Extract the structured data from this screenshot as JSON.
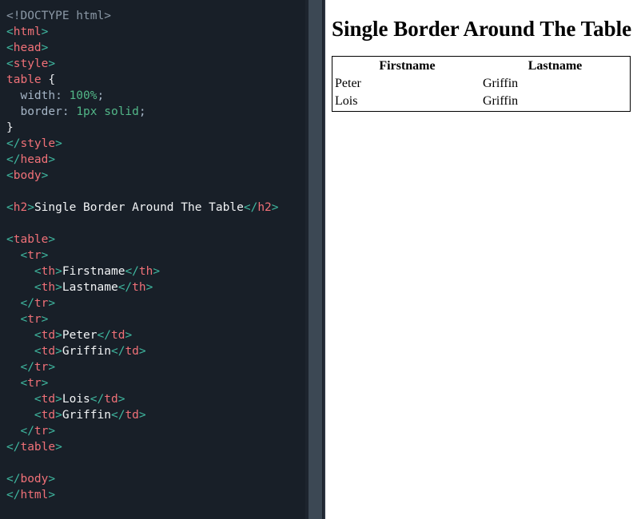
{
  "editor": {
    "language": "html",
    "background_color": "#181f28",
    "code_lines": [
      [
        {
          "t": "doctype",
          "s": "<!DOCTYPE html>"
        }
      ],
      [
        {
          "t": "punct",
          "s": "<"
        },
        {
          "t": "tag",
          "s": "html"
        },
        {
          "t": "punct",
          "s": ">"
        }
      ],
      [
        {
          "t": "punct",
          "s": "<"
        },
        {
          "t": "tag",
          "s": "head"
        },
        {
          "t": "punct",
          "s": ">"
        }
      ],
      [
        {
          "t": "punct",
          "s": "<"
        },
        {
          "t": "tag",
          "s": "style"
        },
        {
          "t": "punct",
          "s": ">"
        }
      ],
      [
        {
          "t": "sel",
          "s": "table"
        },
        {
          "t": "text",
          "s": " "
        },
        {
          "t": "brace",
          "s": "{"
        }
      ],
      [
        {
          "t": "prop",
          "s": "  width"
        },
        {
          "t": "semi",
          "s": ": "
        },
        {
          "t": "val",
          "s": "100%"
        },
        {
          "t": "semi",
          "s": ";"
        }
      ],
      [
        {
          "t": "prop",
          "s": "  border"
        },
        {
          "t": "semi",
          "s": ": "
        },
        {
          "t": "val",
          "s": "1px solid"
        },
        {
          "t": "semi",
          "s": ";"
        }
      ],
      [
        {
          "t": "brace",
          "s": "}"
        }
      ],
      [
        {
          "t": "punct",
          "s": "</"
        },
        {
          "t": "tag",
          "s": "style"
        },
        {
          "t": "punct",
          "s": ">"
        }
      ],
      [
        {
          "t": "punct",
          "s": "</"
        },
        {
          "t": "tag",
          "s": "head"
        },
        {
          "t": "punct",
          "s": ">"
        }
      ],
      [
        {
          "t": "punct",
          "s": "<"
        },
        {
          "t": "tag",
          "s": "body"
        },
        {
          "t": "punct",
          "s": ">"
        }
      ],
      [],
      [
        {
          "t": "punct",
          "s": "<"
        },
        {
          "t": "tag",
          "s": "h2"
        },
        {
          "t": "punct",
          "s": ">"
        },
        {
          "t": "text",
          "s": "Single Border Around The Table"
        },
        {
          "t": "punct",
          "s": "</"
        },
        {
          "t": "tag",
          "s": "h2"
        },
        {
          "t": "punct",
          "s": ">"
        }
      ],
      [],
      [
        {
          "t": "punct",
          "s": "<"
        },
        {
          "t": "tag",
          "s": "table"
        },
        {
          "t": "punct",
          "s": ">"
        }
      ],
      [
        {
          "t": "punct",
          "s": "  <"
        },
        {
          "t": "tag",
          "s": "tr"
        },
        {
          "t": "punct",
          "s": ">"
        }
      ],
      [
        {
          "t": "punct",
          "s": "    <"
        },
        {
          "t": "tag",
          "s": "th"
        },
        {
          "t": "punct",
          "s": ">"
        },
        {
          "t": "text",
          "s": "Firstname"
        },
        {
          "t": "punct",
          "s": "</"
        },
        {
          "t": "tag",
          "s": "th"
        },
        {
          "t": "punct",
          "s": ">"
        }
      ],
      [
        {
          "t": "punct",
          "s": "    <"
        },
        {
          "t": "tag",
          "s": "th"
        },
        {
          "t": "punct",
          "s": ">"
        },
        {
          "t": "text",
          "s": "Lastname"
        },
        {
          "t": "punct",
          "s": "</"
        },
        {
          "t": "tag",
          "s": "th"
        },
        {
          "t": "punct",
          "s": ">"
        }
      ],
      [
        {
          "t": "punct",
          "s": "  </"
        },
        {
          "t": "tag",
          "s": "tr"
        },
        {
          "t": "punct",
          "s": ">"
        }
      ],
      [
        {
          "t": "punct",
          "s": "  <"
        },
        {
          "t": "tag",
          "s": "tr"
        },
        {
          "t": "punct",
          "s": ">"
        }
      ],
      [
        {
          "t": "punct",
          "s": "    <"
        },
        {
          "t": "tag",
          "s": "td"
        },
        {
          "t": "punct",
          "s": ">"
        },
        {
          "t": "text",
          "s": "Peter"
        },
        {
          "t": "punct",
          "s": "</"
        },
        {
          "t": "tag",
          "s": "td"
        },
        {
          "t": "punct",
          "s": ">"
        }
      ],
      [
        {
          "t": "punct",
          "s": "    <"
        },
        {
          "t": "tag",
          "s": "td"
        },
        {
          "t": "punct",
          "s": ">"
        },
        {
          "t": "text",
          "s": "Griffin"
        },
        {
          "t": "punct",
          "s": "</"
        },
        {
          "t": "tag",
          "s": "td"
        },
        {
          "t": "punct",
          "s": ">"
        }
      ],
      [
        {
          "t": "punct",
          "s": "  </"
        },
        {
          "t": "tag",
          "s": "tr"
        },
        {
          "t": "punct",
          "s": ">"
        }
      ],
      [
        {
          "t": "punct",
          "s": "  <"
        },
        {
          "t": "tag",
          "s": "tr"
        },
        {
          "t": "punct",
          "s": ">"
        }
      ],
      [
        {
          "t": "punct",
          "s": "    <"
        },
        {
          "t": "tag",
          "s": "td"
        },
        {
          "t": "punct",
          "s": ">"
        },
        {
          "t": "text",
          "s": "Lois"
        },
        {
          "t": "punct",
          "s": "</"
        },
        {
          "t": "tag",
          "s": "td"
        },
        {
          "t": "punct",
          "s": ">"
        }
      ],
      [
        {
          "t": "punct",
          "s": "    <"
        },
        {
          "t": "tag",
          "s": "td"
        },
        {
          "t": "punct",
          "s": ">"
        },
        {
          "t": "text",
          "s": "Griffin"
        },
        {
          "t": "punct",
          "s": "</"
        },
        {
          "t": "tag",
          "s": "td"
        },
        {
          "t": "punct",
          "s": ">"
        }
      ],
      [
        {
          "t": "punct",
          "s": "  </"
        },
        {
          "t": "tag",
          "s": "tr"
        },
        {
          "t": "punct",
          "s": ">"
        }
      ],
      [
        {
          "t": "punct",
          "s": "</"
        },
        {
          "t": "tag",
          "s": "table"
        },
        {
          "t": "punct",
          "s": ">"
        }
      ],
      [],
      [
        {
          "t": "punct",
          "s": "</"
        },
        {
          "t": "tag",
          "s": "body"
        },
        {
          "t": "punct",
          "s": ">"
        }
      ],
      [
        {
          "t": "punct",
          "s": "</"
        },
        {
          "t": "tag",
          "s": "html"
        },
        {
          "t": "punct",
          "s": ">"
        }
      ]
    ]
  },
  "scrollbar": {
    "track_color": "#1d242e",
    "thumb_color": "#3c4854"
  },
  "preview": {
    "background_color": "#ffffff",
    "heading": "Single Border Around The Table",
    "table": {
      "border": "1px solid",
      "border_color": "#000000",
      "width": "100%",
      "headers": [
        "Firstname",
        "Lastname"
      ],
      "rows": [
        [
          "Peter",
          "Griffin"
        ],
        [
          "Lois",
          "Griffin"
        ]
      ]
    }
  }
}
